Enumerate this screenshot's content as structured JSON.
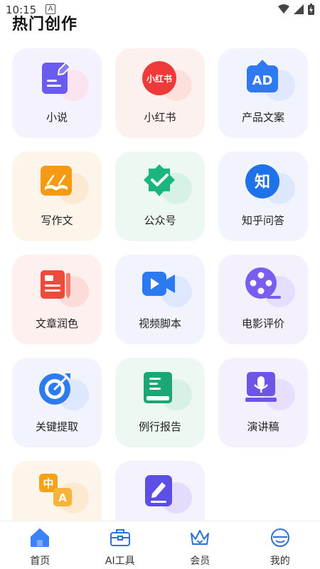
{
  "status_bar": {
    "time": "10:15",
    "notification_letter": "A"
  },
  "page_title": "热门创作",
  "cards": [
    {
      "label": "小说",
      "icon": "pencil-note-icon",
      "bg": "#f3f2fd",
      "blob": "#fbe3f0",
      "accent": "#6a5cf0"
    },
    {
      "label": "小红书",
      "icon": "xiaohongshu-icon",
      "bg": "#fdf1ef",
      "blob": "#fde0dc",
      "accent": "#ef3a3a",
      "icon_text": "小红书"
    },
    {
      "label": "产品文案",
      "icon": "ad-icon",
      "bg": "#f1f4fd",
      "blob": "#dfe8fd",
      "accent": "#2f79f2",
      "icon_text": "AD"
    },
    {
      "label": "写作文",
      "icon": "open-book-icon",
      "bg": "#fdf4ea",
      "blob": "#fde9d2",
      "accent": "#f59a12"
    },
    {
      "label": "公众号",
      "icon": "verified-badge-icon",
      "bg": "#edf8f3",
      "blob": "#d7f1e4",
      "accent": "#1bb57e"
    },
    {
      "label": "知乎问答",
      "icon": "zhihu-icon",
      "bg": "#f1f4fd",
      "blob": "#dde7fd",
      "accent": "#1f72e8",
      "icon_text": "知"
    },
    {
      "label": "文章润色",
      "icon": "newspaper-pen-icon",
      "bg": "#fdf0ee",
      "blob": "#fbdcd8",
      "accent": "#ee4b3d"
    },
    {
      "label": "视频脚本",
      "icon": "video-camera-icon",
      "bg": "#f1f4fd",
      "blob": "#dde7fd",
      "accent": "#2b7af0"
    },
    {
      "label": "电影评价",
      "icon": "film-reel-icon",
      "bg": "#f4f1fd",
      "blob": "#e6defd",
      "accent": "#7a5cf0"
    },
    {
      "label": "关键提取",
      "icon": "target-icon",
      "bg": "#f1f4fd",
      "blob": "#dde7fd",
      "accent": "#2d7bf0"
    },
    {
      "label": "例行报告",
      "icon": "report-book-icon",
      "bg": "#edf8f3",
      "blob": "#d7f1e4",
      "accent": "#1aa775"
    },
    {
      "label": "演讲稿",
      "icon": "microphone-script-icon",
      "bg": "#f4f1fd",
      "blob": "#e8defd",
      "accent": "#6e55e8"
    },
    {
      "label": "",
      "icon": "translate-icon",
      "bg": "#fdf4ea",
      "blob": "#fde9d2",
      "accent": "#f5a315",
      "icon_text": "中",
      "icon_text2": "A"
    },
    {
      "label": "",
      "icon": "document-edit-icon",
      "bg": "#f3f2fd",
      "blob": "#e3ddfb",
      "accent": "#5c4fe6"
    }
  ],
  "tabs": [
    {
      "label": "首页",
      "icon": "home-icon",
      "active": true
    },
    {
      "label": "AI工具",
      "icon": "toolbox-icon",
      "active": false
    },
    {
      "label": "会员",
      "icon": "crown-icon",
      "active": false
    },
    {
      "label": "我的",
      "icon": "profile-face-icon",
      "active": false
    }
  ],
  "colors": {
    "tab_active": "#3a82f7",
    "tab_inactive": "#2f6fd6"
  }
}
